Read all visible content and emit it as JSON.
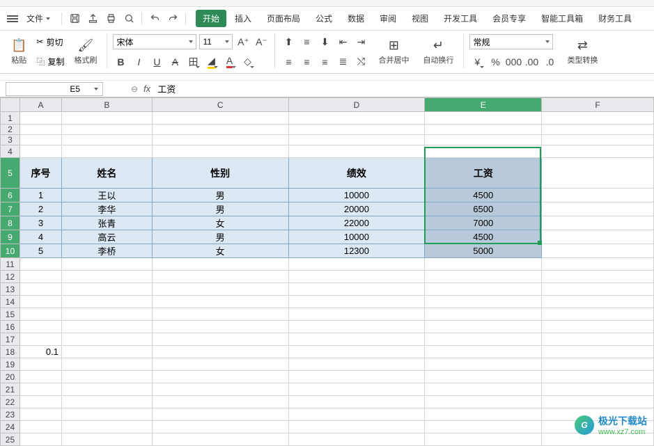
{
  "menu": {
    "file": "文件",
    "tabs": [
      "开始",
      "插入",
      "页面布局",
      "公式",
      "数据",
      "审阅",
      "视图",
      "开发工具",
      "会员专享",
      "智能工具箱",
      "财务工具"
    ],
    "active_tab": 0
  },
  "toolbar": {
    "paste": "粘贴",
    "cut": "剪切",
    "copy": "复制",
    "format_painter": "格式刷",
    "font_name": "宋体",
    "font_size": "11",
    "merge_center": "合并居中",
    "wrap_text": "自动换行",
    "number_format": "常规",
    "type_convert": "类型转换"
  },
  "formula_bar": {
    "cell_ref": "E5",
    "formula": "工资"
  },
  "columns": [
    "A",
    "B",
    "C",
    "D",
    "E",
    "F"
  ],
  "table": {
    "headers": [
      "序号",
      "姓名",
      "性别",
      "绩效",
      "工资"
    ],
    "rows": [
      {
        "id": "1",
        "name": "王以",
        "gender": "男",
        "perf": "10000",
        "salary": "4500"
      },
      {
        "id": "2",
        "name": "李华",
        "gender": "男",
        "perf": "20000",
        "salary": "6500"
      },
      {
        "id": "3",
        "name": "张青",
        "gender": "女",
        "perf": "22000",
        "salary": "7000"
      },
      {
        "id": "4",
        "name": "高云",
        "gender": "男",
        "perf": "10000",
        "salary": "4500"
      },
      {
        "id": "5",
        "name": "李桥",
        "gender": "女",
        "perf": "12300",
        "salary": "5000"
      }
    ]
  },
  "extra_cells": {
    "A18": "0.1"
  },
  "watermark": {
    "line1": "极光下载站",
    "line2": "www.xz7.com"
  },
  "chart_data": {
    "type": "table",
    "title": "工资",
    "columns": [
      "序号",
      "姓名",
      "性别",
      "绩效",
      "工资"
    ],
    "rows": [
      [
        1,
        "王以",
        "男",
        10000,
        4500
      ],
      [
        2,
        "李华",
        "男",
        20000,
        6500
      ],
      [
        3,
        "张青",
        "女",
        22000,
        7000
      ],
      [
        4,
        "高云",
        "男",
        10000,
        4500
      ],
      [
        5,
        "李桥",
        "女",
        12300,
        5000
      ]
    ]
  }
}
